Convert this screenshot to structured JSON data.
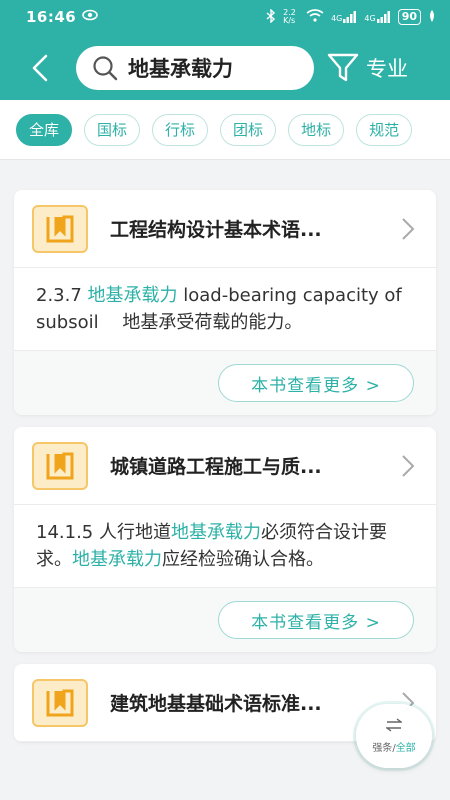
{
  "status": {
    "time": "16:46",
    "network_speed": "2.2 K/s",
    "signal1": "4G",
    "signal2": "4G",
    "battery": "90"
  },
  "search": {
    "value": "地基承载力"
  },
  "filter": {
    "label": "专业"
  },
  "tabs": [
    {
      "label": "全库",
      "active": true
    },
    {
      "label": "国标"
    },
    {
      "label": "行标"
    },
    {
      "label": "团标"
    },
    {
      "label": "地标"
    },
    {
      "label": "规范"
    }
  ],
  "results": [
    {
      "title": "工程结构设计基本术语...",
      "snippet_pre": "2.3.7 ",
      "snippet_hl": "地基承载力",
      "snippet_post": " load-bearing capacity of subsoil　 地基承受荷载的能力。",
      "more_label": "本书查看更多 >"
    },
    {
      "title": "城镇道路工程施工与质...",
      "snippet_pre": "14.1.5 人行地道",
      "snippet_hl": "地基承载力",
      "snippet_mid": "必须符合设计要求。",
      "snippet_hl2": "地基承载力",
      "snippet_post": "应经检验确认合格。",
      "more_label": "本书查看更多 >"
    },
    {
      "title": "建筑地基基础术语标准..."
    }
  ],
  "float_toggle": {
    "option1": "强条",
    "sep": "/",
    "option2": "全部"
  },
  "colors": {
    "accent": "#2eb1a7",
    "book_icon_bg": "#fdecc8",
    "book_icon_border": "#f6c768"
  }
}
